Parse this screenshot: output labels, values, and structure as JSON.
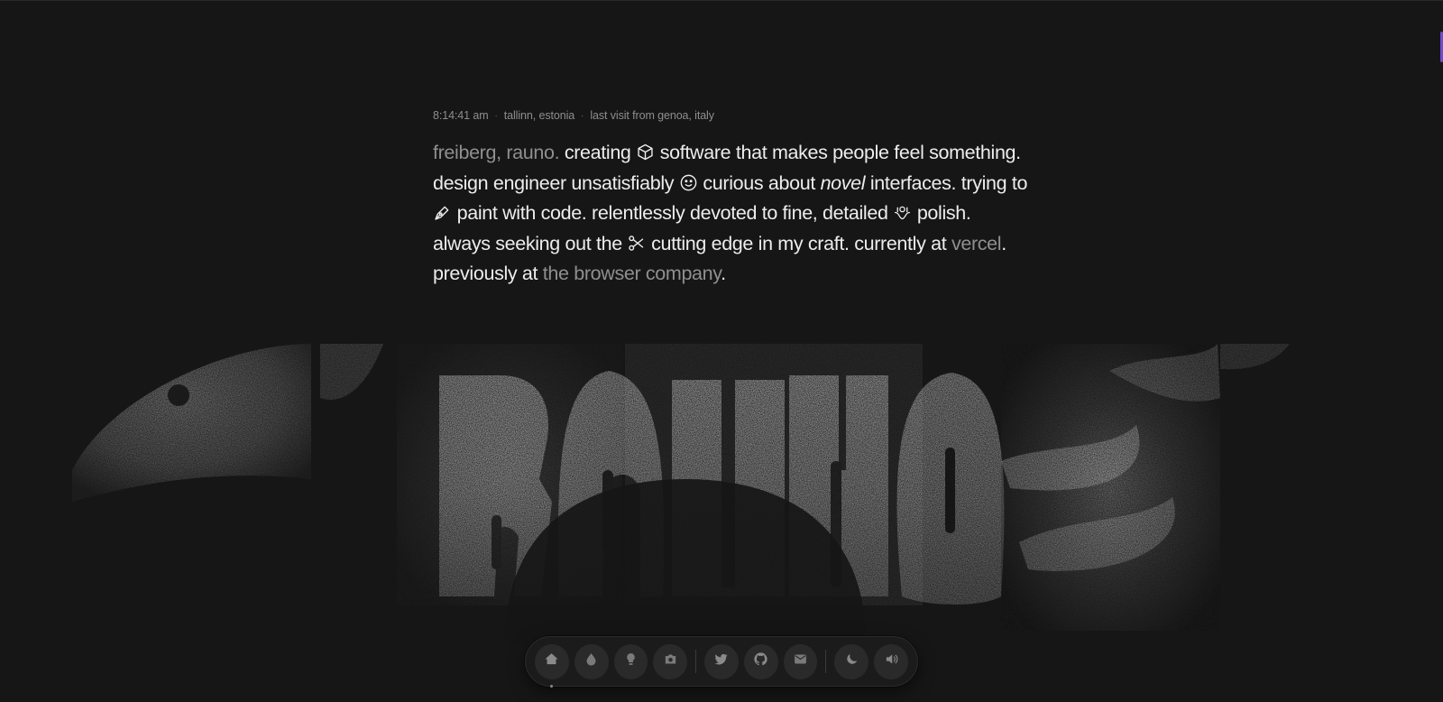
{
  "meta": {
    "time": "8:14:41 am",
    "location": "tallinn, estonia",
    "last_visit": "last visit from genoa, italy"
  },
  "bio": {
    "name": "freiberg, rauno.",
    "p1": " creating ",
    "p2": " software that makes people feel something. design engineer unsatisfiably ",
    "p3": " curious about ",
    "novel": "novel",
    "p4": " interfaces. trying to ",
    "p5": " paint with code. relentlessly devoted to fine, detailed ",
    "p6": " polish. always seeking out the ",
    "p7": " cutting edge in my craft. currently at ",
    "vercel": "vercel",
    "p8": ". previously at ",
    "browser_company": "the browser company",
    "p9": "."
  },
  "hero": {
    "wordmark": "RAUNO"
  },
  "dock": {
    "items": [
      "home-icon",
      "drop-icon",
      "bulb-icon",
      "camera-icon",
      "twitter-icon",
      "github-icon",
      "mail-icon",
      "moon-icon",
      "speaker-icon"
    ]
  },
  "colors": {
    "background": "#161616",
    "text": "#ededed",
    "muted": "#8f8f8f",
    "dock": "#1b1b1b"
  }
}
